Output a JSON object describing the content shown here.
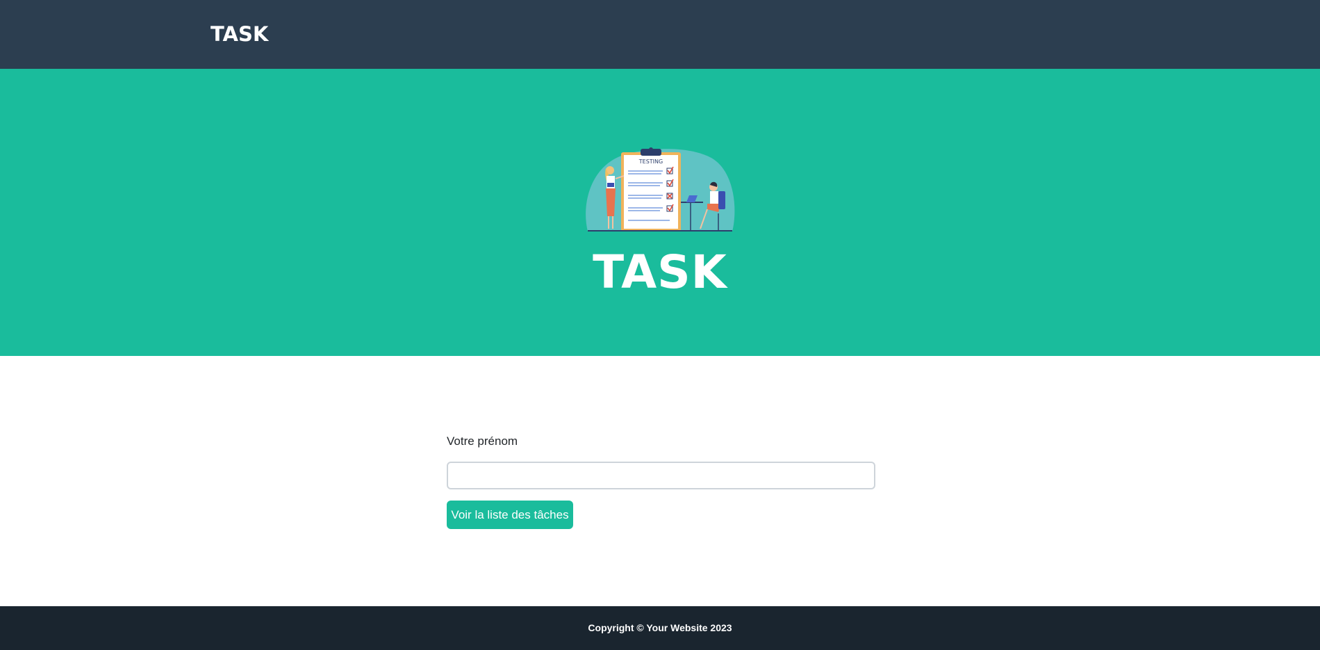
{
  "navbar": {
    "brand": "TASK"
  },
  "masthead": {
    "illustration_icon": "testing-checklist-illustration",
    "illustration_text": "TESTING",
    "heading": "TASK"
  },
  "form": {
    "label": "Votre prénom",
    "input_value": "",
    "input_placeholder": "",
    "button_label": "Voir la liste des tâches"
  },
  "footer": {
    "copyright": "Copyright © Your Website 2023"
  },
  "colors": {
    "navbar": "#2c3e50",
    "accent": "#1abc9c",
    "footer": "#1a252f",
    "text": "#212529"
  }
}
